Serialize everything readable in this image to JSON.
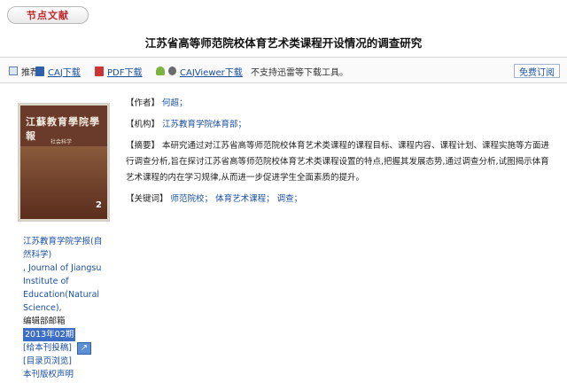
{
  "header": {
    "tab_label": "节点文献",
    "article_title": "江苏省高等师范院校体育艺术类课程开设情况的调查研究"
  },
  "toolbar": {
    "recommend": "推荐",
    "caj_download": "CAJ下载",
    "pdf_download": "PDF下载",
    "cajviewer_download": "CAJViewer下载",
    "notice": "不支持迅雷等下载工具。",
    "subscribe": "免费订阅"
  },
  "cover": {
    "title": "江蘇教育學院學報",
    "subtitle": "社会科学",
    "issue_number": "2"
  },
  "journal_info": {
    "journal_name": "江苏教育学院学报(自然科学)",
    "journal_en": ", Journal of Jiangsu Institute of Education(Natural Science),",
    "editor_office": "编辑部邮箱",
    "issue": "2013年02期",
    "submit": "[给本刊投稿]",
    "toc": "[目录页浏览]",
    "copyright": "本刊版权声明"
  },
  "details": {
    "author_label": "【作者】",
    "author": "何超；",
    "institution_label": "【机构】",
    "institution": "江苏教育学院体育部；",
    "abstract_label": "【摘要】",
    "abstract": "本研究通过对江苏省高等师范院校体育艺术类课程的课程目标、课程内容、课程计划、课程实施等方面进行调查分析,旨在探讨江苏省高等师范院校体育艺术类课程设置的特点,把握其发展态势,通过调查分析,试图揭示体育艺术课程的内在学习规律,从而进一步促进学生全面素质的提升。",
    "keywords_label": "【关键词】",
    "keywords": [
      "师范院校；",
      "体育艺术课程；",
      "调查；"
    ]
  }
}
